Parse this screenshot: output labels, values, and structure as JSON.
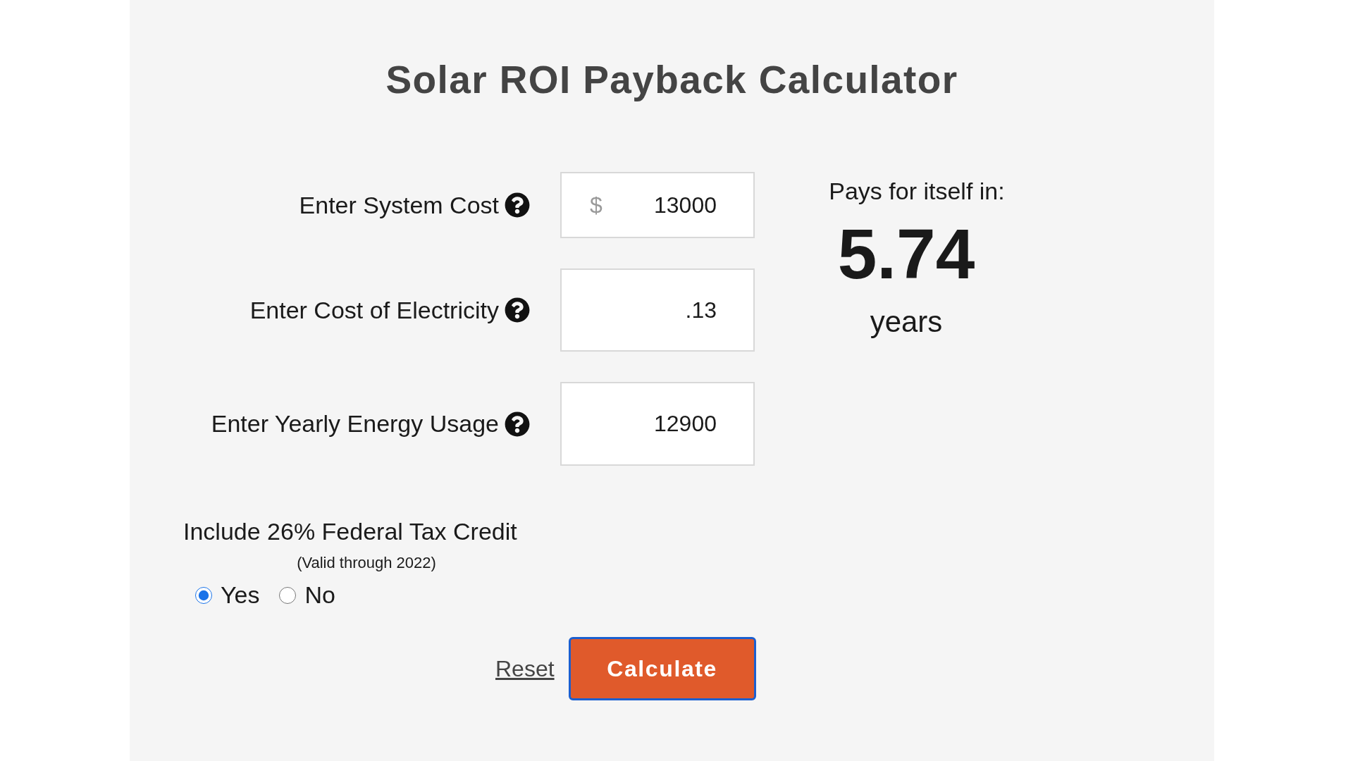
{
  "title": "Solar ROI Payback Calculator",
  "fields": [
    {
      "label": "Enter System Cost",
      "prefix": "$",
      "value": "13000"
    },
    {
      "label": "Enter Cost of Electricity",
      "value": ".13"
    },
    {
      "label": "Enter Yearly Energy Usage",
      "value": "12900"
    }
  ],
  "result": {
    "heading": "Pays for itself in:",
    "value": "5.74",
    "unit": "years"
  },
  "tax_credit": {
    "label": "Include 26% Federal Tax Credit",
    "note": "(Valid through 2022)",
    "options": [
      {
        "label": "Yes",
        "selected": true
      },
      {
        "label": "No",
        "selected": false
      }
    ]
  },
  "actions": {
    "reset": "Reset",
    "calculate": "Calculate"
  }
}
